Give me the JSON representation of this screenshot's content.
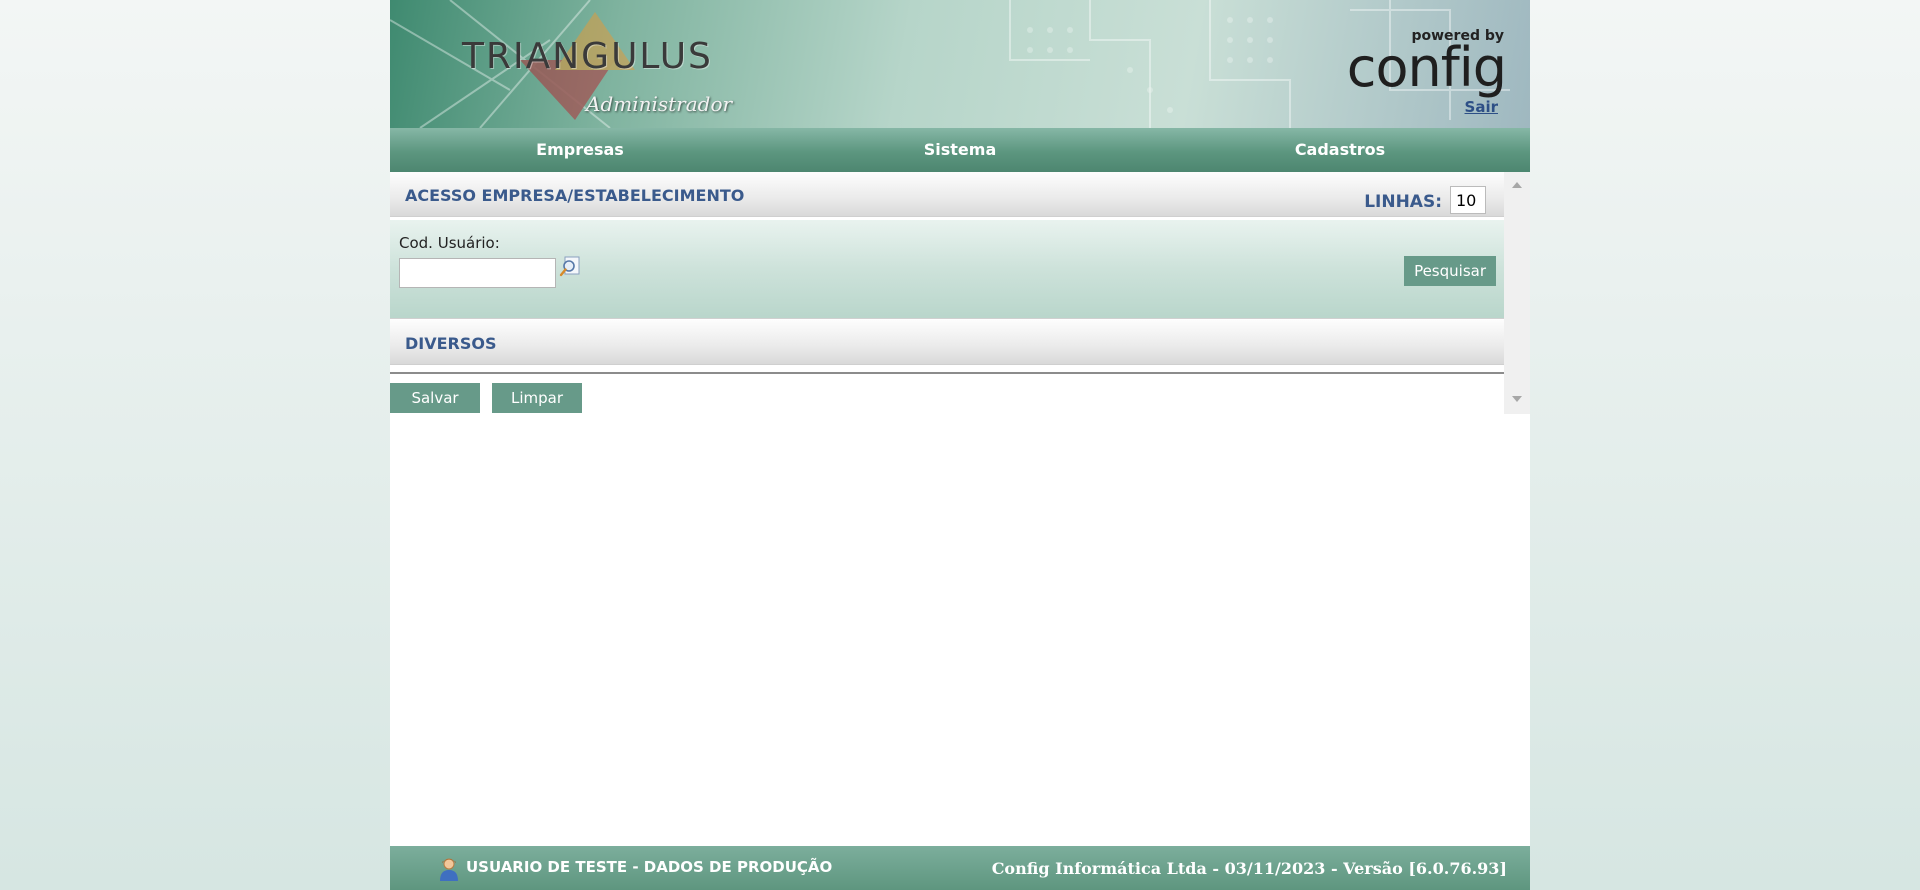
{
  "header": {
    "logo": "TRIANGULUS",
    "logo_subtitle": "Administrador",
    "powered_by": "powered by",
    "brand": "config",
    "logout_label": "Sair"
  },
  "menu": {
    "items": [
      {
        "label": "Empresas"
      },
      {
        "label": "Sistema"
      },
      {
        "label": "Cadastros"
      }
    ]
  },
  "section_access": {
    "title": "ACESSO EMPRESA/ESTABELECIMENTO",
    "lines_label": "LINHAS:",
    "lines_value": "10"
  },
  "filters": {
    "user_code_label": "Cod. Usuário:",
    "user_code_value": "",
    "search_label": "Pesquisar",
    "lookup_icon": "search-lookup-icon"
  },
  "section_misc": {
    "title": "DIVERSOS"
  },
  "actions": {
    "save_label": "Salvar",
    "clear_label": "Limpar"
  },
  "footer": {
    "user_text": "USUARIO DE TESTE - DADOS DE PRODUÇÃO",
    "company_info": "Config Informática Ltda - 03/11/2023 - Versão [6.0.76.93]",
    "user_icon": "user-icon"
  },
  "colors": {
    "accent_green": "#679a89",
    "heading_blue": "#3a5a8c"
  }
}
